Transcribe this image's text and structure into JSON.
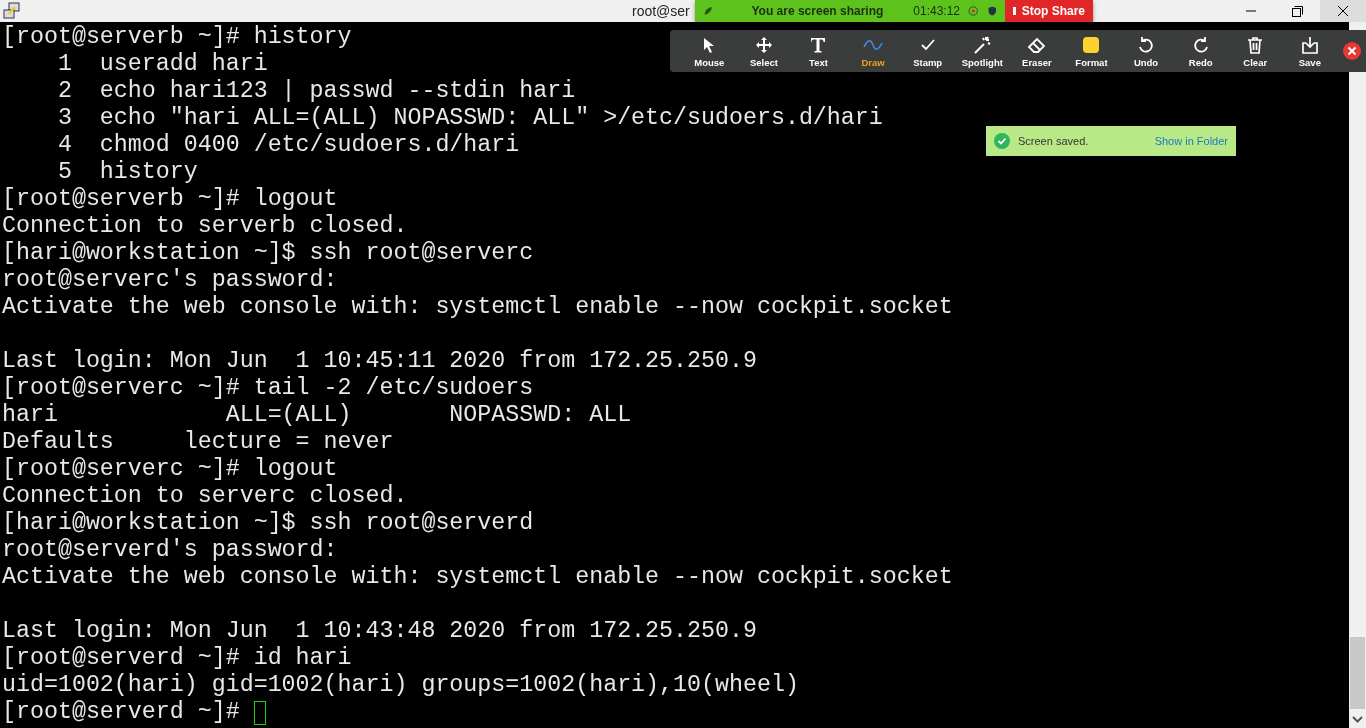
{
  "window": {
    "title": "root@ser"
  },
  "share_bar": {
    "status": "You are screen sharing",
    "timer": "01:43:12",
    "stop_label": "Stop Share"
  },
  "annotation_toolbar": {
    "tools": [
      {
        "kind": "mouse",
        "label": "Mouse",
        "selected": false
      },
      {
        "kind": "select",
        "label": "Select",
        "selected": false
      },
      {
        "kind": "text",
        "label": "Text",
        "selected": false
      },
      {
        "kind": "draw",
        "label": "Draw",
        "selected": true
      },
      {
        "kind": "stamp",
        "label": "Stamp",
        "selected": false
      },
      {
        "kind": "spotlight",
        "label": "Spotlight",
        "selected": false
      },
      {
        "kind": "eraser",
        "label": "Eraser",
        "selected": false
      },
      {
        "kind": "format",
        "label": "Format",
        "selected": false
      },
      {
        "kind": "undo",
        "label": "Undo",
        "selected": false
      },
      {
        "kind": "redo",
        "label": "Redo",
        "selected": false
      },
      {
        "kind": "clear",
        "label": "Clear",
        "selected": false
      },
      {
        "kind": "save",
        "label": "Save",
        "selected": false
      }
    ]
  },
  "toast": {
    "message": "Screen saved.",
    "link": "Show in Folder"
  },
  "terminal": {
    "cursor": true,
    "blocks": [
      [
        "[root@serverb ~]# history",
        "    1  useradd hari",
        "    2  echo hari123 | passwd --stdin hari",
        "    3  echo \"hari ALL=(ALL) NOPASSWD: ALL\" >/etc/sudoers.d/hari",
        "    4  chmod 0400 /etc/sudoers.d/hari",
        "    5  history",
        "[root@serverb ~]# logout",
        "Connection to serverb closed.",
        "[hari@workstation ~]$ ssh root@serverc",
        "root@serverc's password:",
        "Activate the web console with: systemctl enable --now cockpit.socket"
      ],
      [
        "Last login: Mon Jun  1 10:45:11 2020 from 172.25.250.9",
        "[root@serverc ~]# tail -2 /etc/sudoers",
        "hari            ALL=(ALL)       NOPASSWD: ALL",
        "Defaults     lecture = never",
        "[root@serverc ~]# logout",
        "Connection to serverc closed.",
        "[hari@workstation ~]$ ssh root@serverd",
        "root@serverd's password:",
        "Activate the web console with: systemctl enable --now cockpit.socket"
      ],
      [
        "Last login: Mon Jun  1 10:43:48 2020 from 172.25.250.9",
        "[root@serverd ~]# id hari",
        "uid=1002(hari) gid=1002(hari) groups=1002(hari),10(wheel)",
        "[root@serverd ~]# "
      ]
    ]
  }
}
